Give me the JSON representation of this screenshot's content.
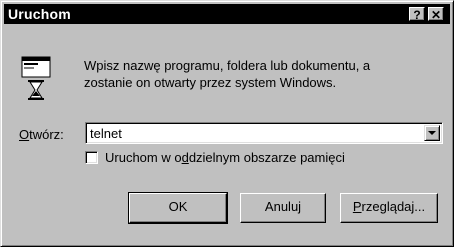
{
  "window": {
    "title": "Uruchom",
    "help_button": "?",
    "close_button": "✕"
  },
  "description": {
    "line1": "Wpisz nazwę programu, foldera lub dokumentu, a",
    "line2": "zostanie on otwarty przez system Windows."
  },
  "open": {
    "label_accel": "O",
    "label_rest": "twórz:",
    "value": "telnet"
  },
  "option": {
    "label_pre": "Uruchom w o",
    "label_accel": "d",
    "label_post": "dzielnym obszarze pamięci",
    "checked": false
  },
  "buttons": {
    "ok": "OK",
    "cancel": "Anuluj",
    "browse_accel": "P",
    "browse_rest": "rzeglądaj..."
  },
  "icons": {
    "run": "run-program-icon",
    "combo_dropdown": "chevron-down-icon"
  }
}
